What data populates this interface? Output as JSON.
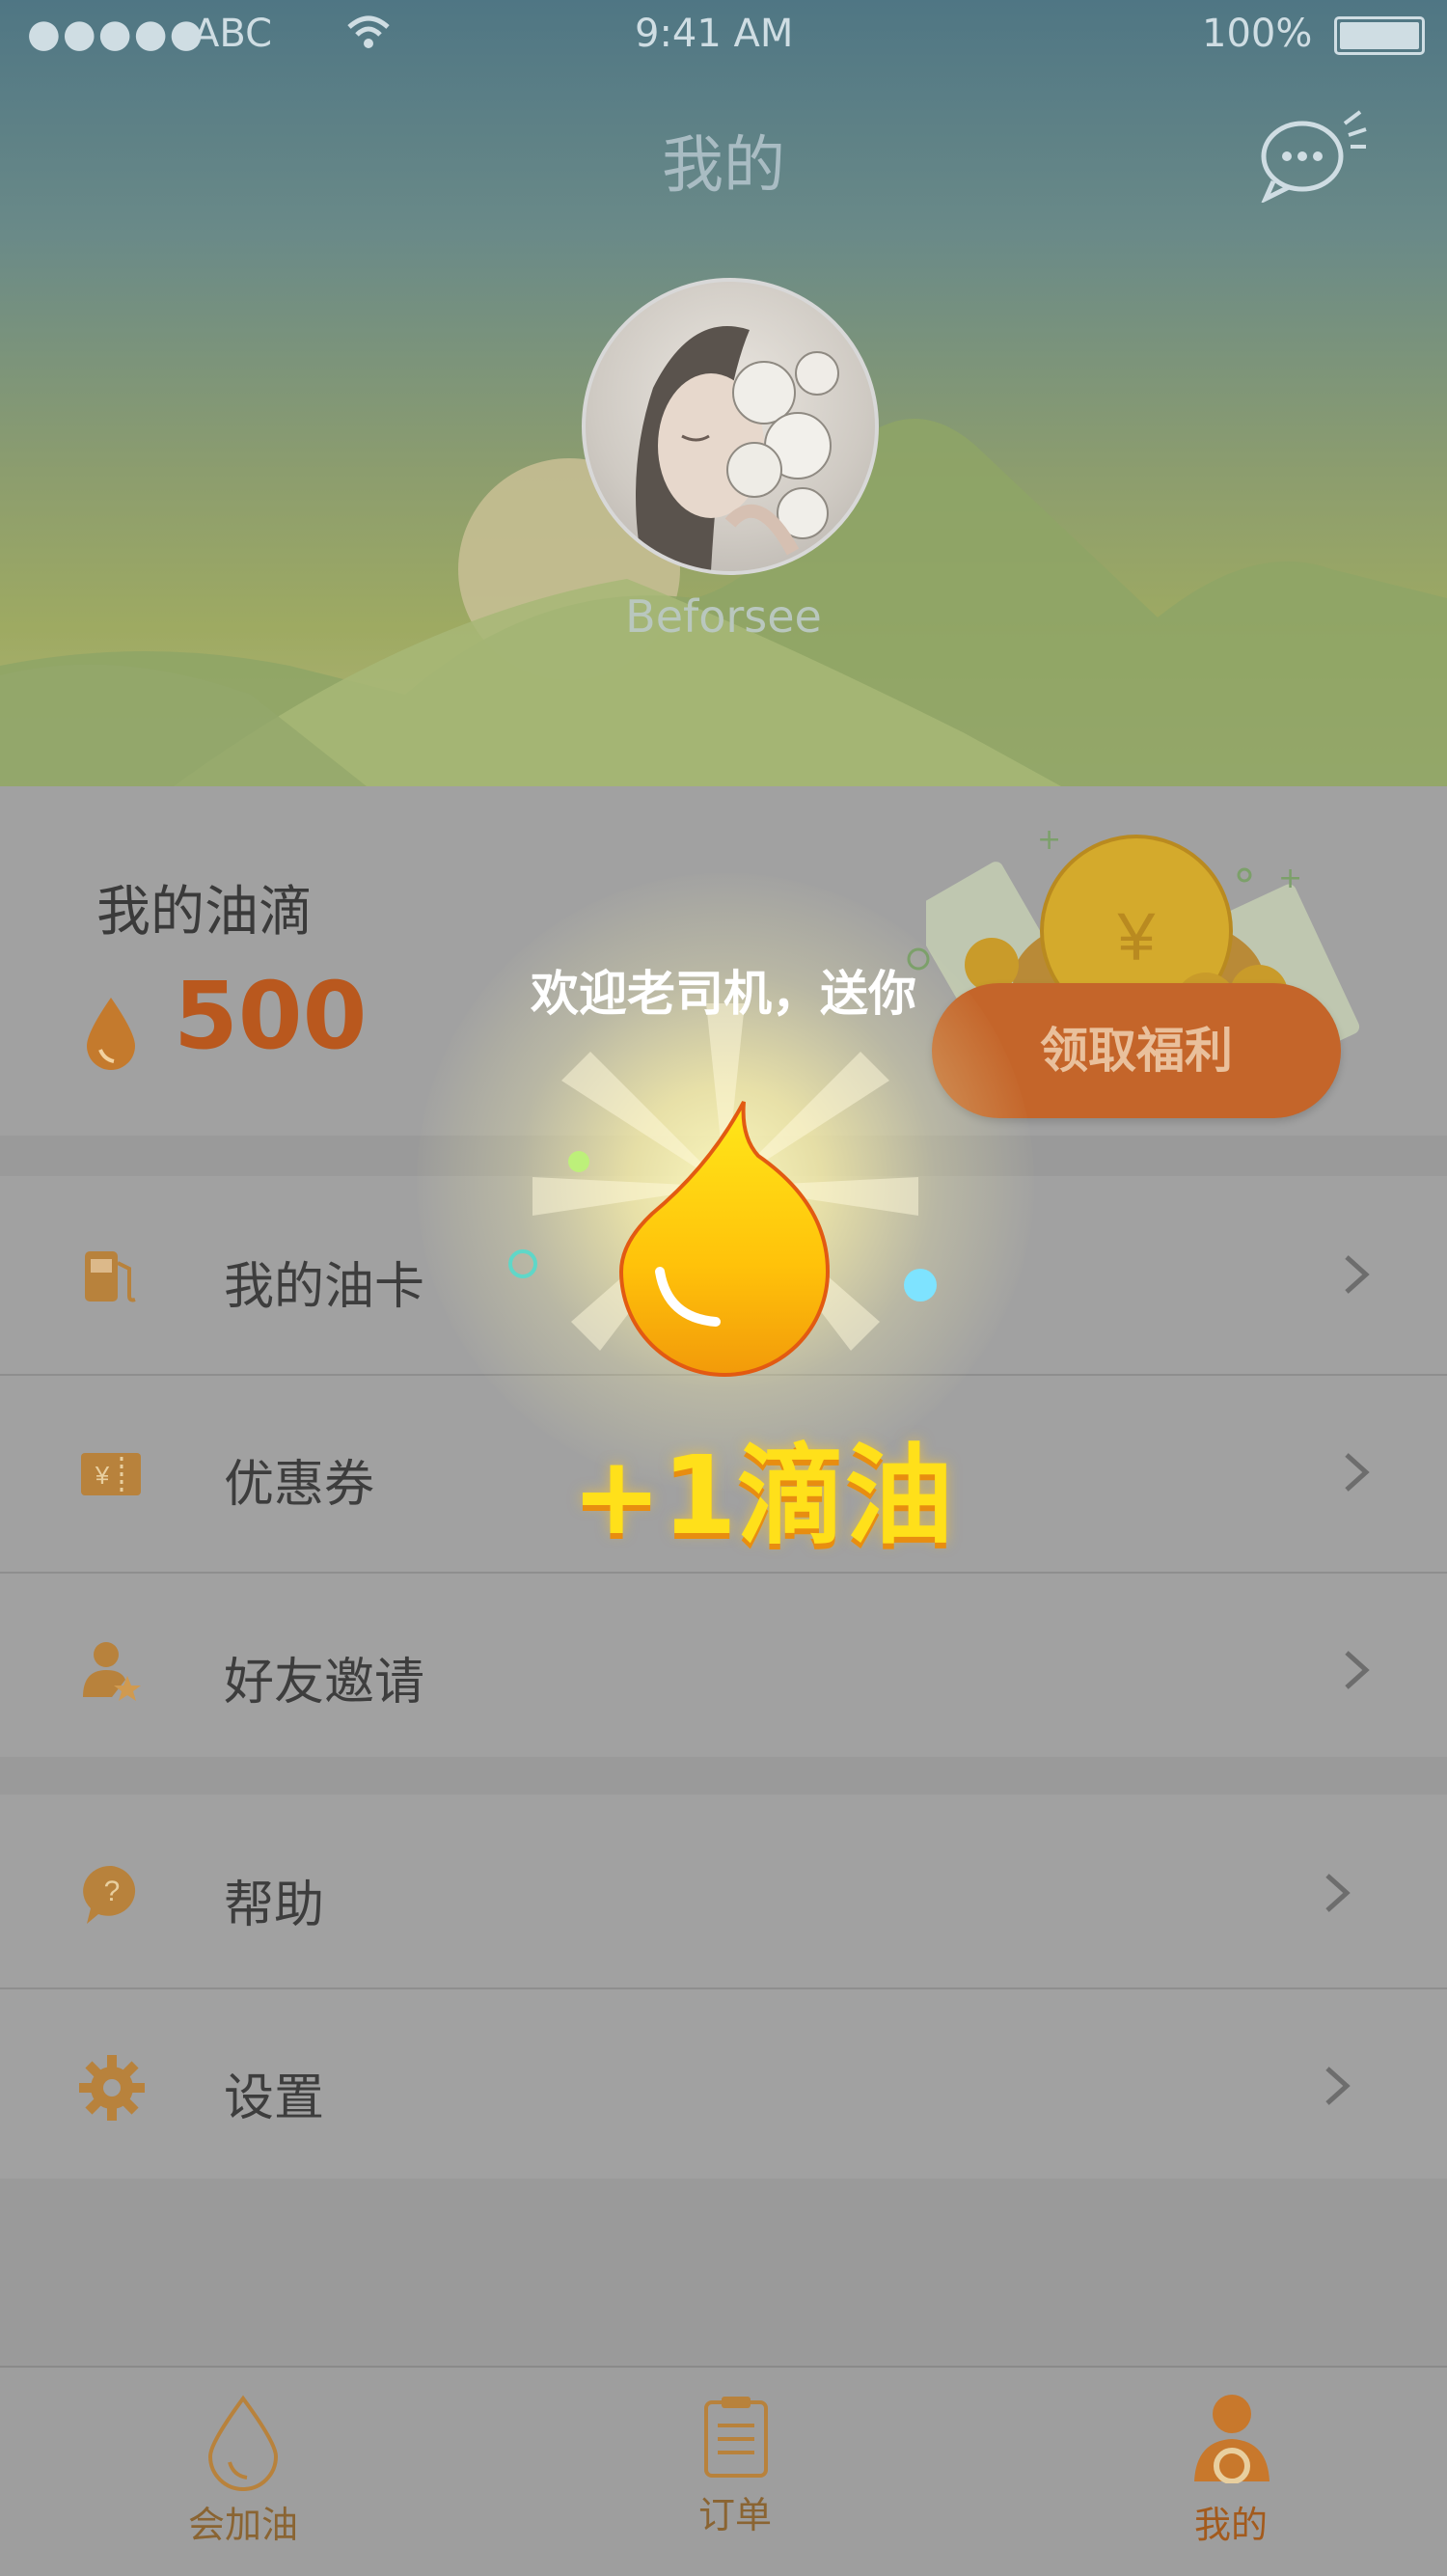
{
  "status_bar": {
    "signal": "●●●●●",
    "carrier": "ABC",
    "time": "9:41 AM",
    "battery": "100%"
  },
  "header": {
    "title": "我的",
    "username": "Beforsee",
    "message_icon": "chat-bubble-icon"
  },
  "points": {
    "label": "我的油滴",
    "value": "500",
    "claim_button": "领取福利"
  },
  "menu_1": [
    {
      "label": "我的油卡",
      "icon": "fuel-pump-icon"
    },
    {
      "label": "优惠券",
      "icon": "coupon-icon"
    },
    {
      "label": "好友邀请",
      "icon": "friend-invite-icon"
    }
  ],
  "menu_2": [
    {
      "label": "帮助",
      "icon": "help-icon"
    },
    {
      "label": "设置",
      "icon": "gear-icon"
    }
  ],
  "popup": {
    "welcome": "欢迎老司机，送你",
    "reward": "+1滴油"
  },
  "tabs": [
    {
      "label": "会加油",
      "icon": "drop-icon"
    },
    {
      "label": "订单",
      "icon": "clipboard-icon"
    },
    {
      "label": "我的",
      "icon": "driver-icon"
    }
  ],
  "colors": {
    "accent": "#c4652a",
    "icon": "#b8823c",
    "reward": "#ffe01a"
  }
}
